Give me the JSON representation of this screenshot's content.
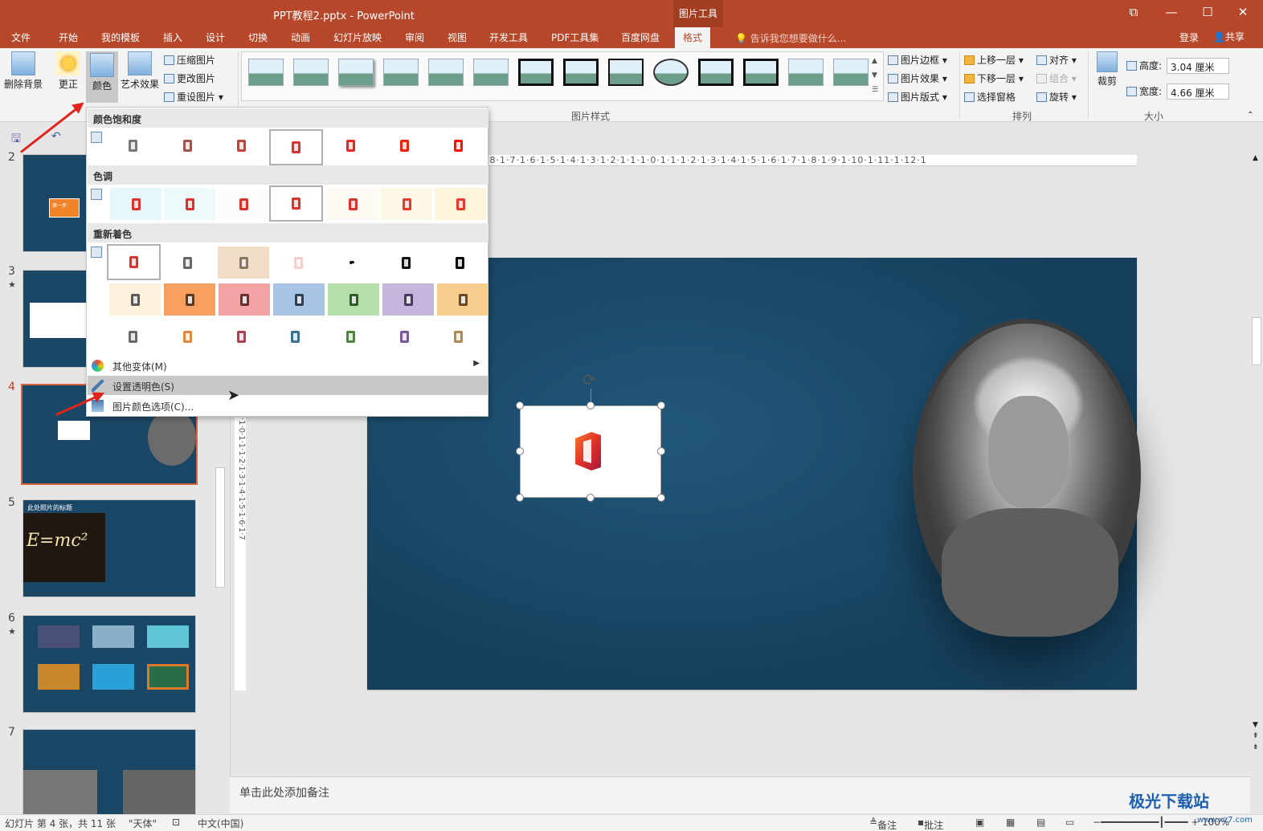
{
  "titlebar": {
    "title": "PPT教程2.pptx - PowerPoint",
    "context_tab": "图片工具"
  },
  "tabs": [
    {
      "label": "文件"
    },
    {
      "label": "开始"
    },
    {
      "label": "我的模板"
    },
    {
      "label": "插入"
    },
    {
      "label": "设计"
    },
    {
      "label": "切换"
    },
    {
      "label": "动画"
    },
    {
      "label": "幻灯片放映"
    },
    {
      "label": "审阅"
    },
    {
      "label": "视图"
    },
    {
      "label": "开发工具"
    },
    {
      "label": "PDF工具集"
    },
    {
      "label": "百度网盘"
    },
    {
      "label": "格式"
    }
  ],
  "tellme": "告诉我您想要做什么...",
  "login": "登录",
  "share": "共享",
  "ribbon": {
    "remove_bg": "删除背景",
    "corrections": "更正",
    "color": "颜色",
    "artistic": "艺术效果",
    "compress": "压缩图片",
    "change_pic": "更改图片",
    "reset_pic": "重设图片",
    "styles_group": "图片样式",
    "border": "图片边框",
    "effects": "图片效果",
    "layout": "图片版式",
    "bring_forward": "上移一层",
    "send_backward": "下移一层",
    "selection_pane": "选择窗格",
    "align": "对齐",
    "group": "组合",
    "rotate": "旋转",
    "arrange_group": "排列",
    "crop": "裁剪",
    "height_label": "高度:",
    "height_value": "3.04 厘米",
    "width_label": "宽度:",
    "width_value": "4.66 厘米",
    "size_group": "大小"
  },
  "color_menu": {
    "saturation_title": "颜色饱和度",
    "tone_title": "色调",
    "recolor_title": "重新着色",
    "more_variations": "其他变体(M)",
    "set_transparent": "设置透明色(S)",
    "color_options": "图片颜色选项(C)..."
  },
  "slides": [
    {
      "number": "2",
      "label": "第一步:"
    },
    {
      "number": "3",
      "label": ""
    },
    {
      "number": "4",
      "label": ""
    },
    {
      "number": "5",
      "label": "此处照片的标题",
      "formula": "E=mc²"
    },
    {
      "number": "6",
      "label": ""
    },
    {
      "number": "7",
      "label": ""
    }
  ],
  "ruler_h": "·8·1·7·1·6·1·5·1·4·1·3·1·2·1·1·1·0·1·1·1·2·1·3·1·4·1·5·1·6·1·7·1·8·1·9·1·10·1·11·1·12·1",
  "ruler_v": "·1·0·1·1·1·2·1·3·1·4·1·5·1·6·1·7",
  "notes_placeholder": "单击此处添加备注",
  "status": {
    "slide_info": "幻灯片 第 4 张，共 11 张",
    "theme": "\"天体\"",
    "language": "中文(中国)",
    "notes": "备注",
    "comments": "批注",
    "zoom": "100%"
  },
  "watermark": "极光下载站",
  "watermark_sub": "www.xz7.com",
  "colors": {
    "accent": "#b7472a",
    "slide_bg": "#1b4766",
    "arrow": "#e0241b"
  }
}
